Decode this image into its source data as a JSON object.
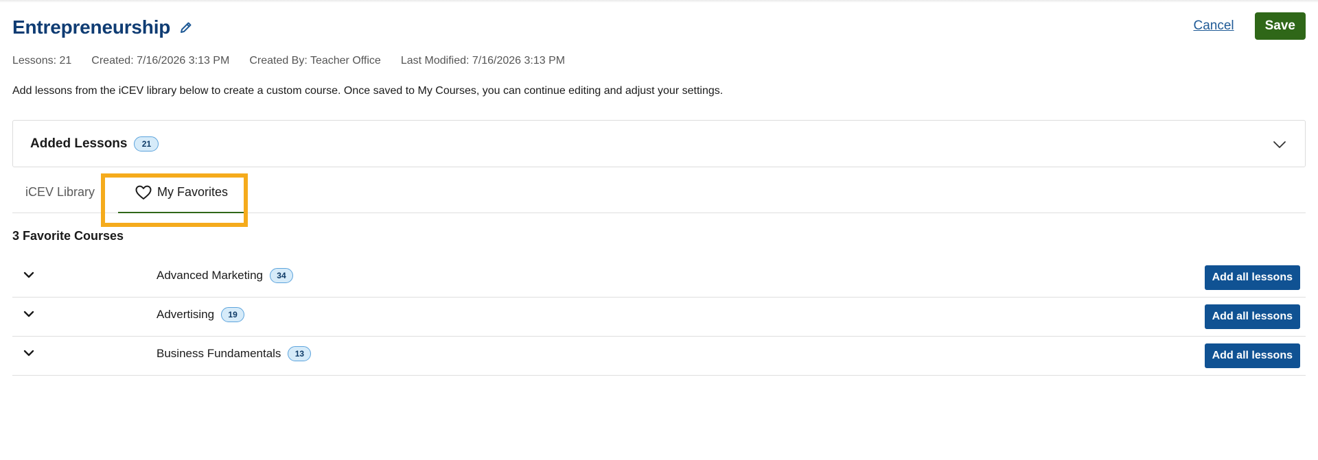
{
  "header": {
    "title": "Entrepreneurship",
    "cancel_label": "Cancel",
    "save_label": "Save"
  },
  "meta": {
    "lessons": "Lessons: 21",
    "created": "Created: 7/16/2026 3:13 PM",
    "created_by": "Created By: Teacher Office",
    "last_modified": "Last Modified: 7/16/2026 3:13 PM"
  },
  "description": "Add lessons from the iCEV library below to create a custom course. Once saved to My Courses, you can continue editing and adjust your settings.",
  "added_lessons": {
    "label": "Added Lessons",
    "count": "21"
  },
  "tabs": [
    {
      "label": "iCEV Library",
      "active": false
    },
    {
      "label": "My Favorites",
      "active": true,
      "icon": "heart-icon"
    }
  ],
  "favorites": {
    "heading": "3 Favorite Courses",
    "add_all_label": "Add all lessons",
    "courses": [
      {
        "name": "Advanced Marketing",
        "count": "34"
      },
      {
        "name": "Advertising",
        "count": "19"
      },
      {
        "name": "Business Fundamentals",
        "count": "13"
      }
    ]
  },
  "colors": {
    "title": "#0f3c73",
    "save_button": "#2f6718",
    "add_button": "#105293",
    "highlight": "#f5ab1c",
    "badge_bg": "#d6ebf9",
    "badge_border": "#5ba3dc"
  }
}
